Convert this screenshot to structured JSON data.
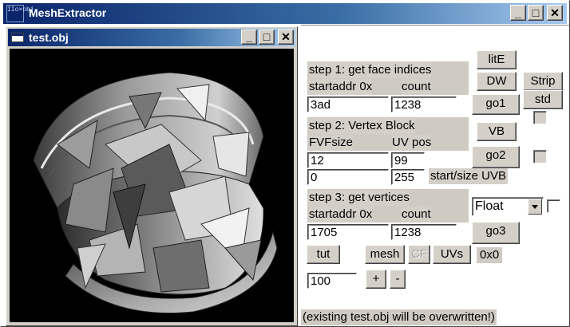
{
  "window": {
    "icon_text": "IIo×obj",
    "title": "MeshExtractor"
  },
  "child_window": {
    "title": "test.obj"
  },
  "caption_buttons": {
    "minimize": "_",
    "maximize": "□",
    "close": "✕"
  },
  "panel": {
    "step1": {
      "heading": "step 1: get face indices",
      "startaddr_label": "startaddr 0x",
      "count_label": "count",
      "startaddr_value": "3ad",
      "count_value": "1238"
    },
    "step2": {
      "heading": "step 2: Vertex Block",
      "fvf_label": "FVFsize",
      "uvpos_label": "UV pos",
      "fvf_value": "12",
      "uvpos_value": "99",
      "start_value": "0",
      "size_value": "255",
      "uvb_label": "start/size UVB"
    },
    "step3": {
      "heading": "step 3: get vertices",
      "startaddr_label": "startaddr 0x",
      "count_label": "count",
      "startaddr_value": "1705",
      "count_value": "1238",
      "format_selected": "Float"
    },
    "buttons": {
      "lite": "litE",
      "dw": "DW",
      "strip": "Strip",
      "std": "std",
      "go1": "go1",
      "vb": "VB",
      "go2": "go2",
      "go3": "go3",
      "tut": "tut",
      "mesh": "mesh",
      "cf": "CF",
      "uvs": "UVs",
      "plus": "+",
      "minus": "-"
    },
    "offset_readout": "0x0",
    "scale_value": "100",
    "warning": "(existing test.obj will be overwritten!)"
  }
}
